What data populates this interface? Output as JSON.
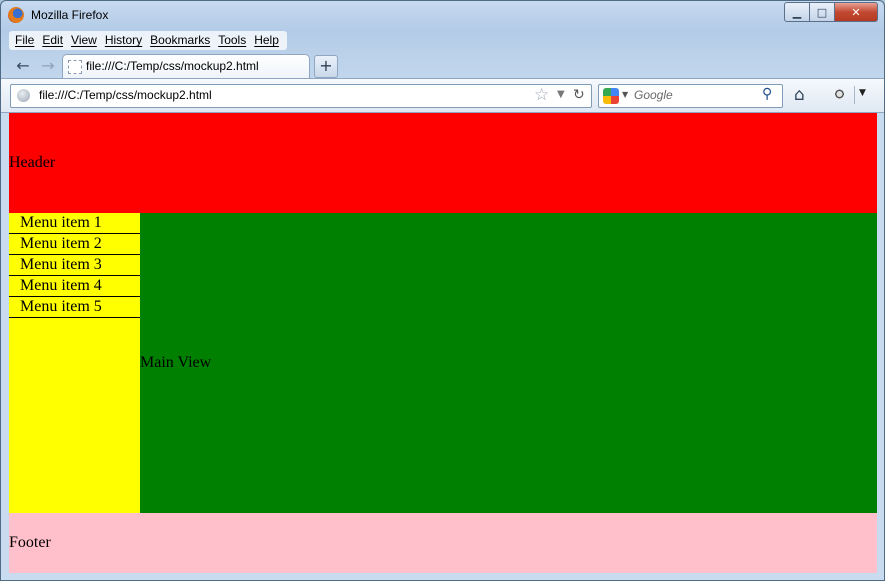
{
  "window": {
    "title": "Mozilla Firefox",
    "controls": {
      "minimize": "▁",
      "maximize": "□",
      "close": "✕"
    }
  },
  "menubar": [
    "File",
    "Edit",
    "View",
    "History",
    "Bookmarks",
    "Tools",
    "Help"
  ],
  "tab": {
    "label": "file:///C:/Temp/css/mockup2.html",
    "new_tab": "+"
  },
  "navbar": {
    "back_icon": "←",
    "forward_icon": "→",
    "url": "file:///C:/Temp/css/mockup2.html",
    "star_icon": "☆",
    "dropdown_icon": "▼",
    "reload_icon": "↻",
    "search": {
      "placeholder": "Google",
      "go_icon": "⚲"
    },
    "home_icon": "⌂",
    "menu_icon": "▼"
  },
  "page": {
    "header": "Header",
    "menu_items": [
      "Menu item 1",
      "Menu item 2",
      "Menu item 3",
      "Menu item 4",
      "Menu item 5"
    ],
    "main": "Main View",
    "footer": "Footer"
  },
  "colors": {
    "header": "#ff0000",
    "sidebar": "#ffff00",
    "main": "#008000",
    "footer": "#ffc0cb"
  }
}
